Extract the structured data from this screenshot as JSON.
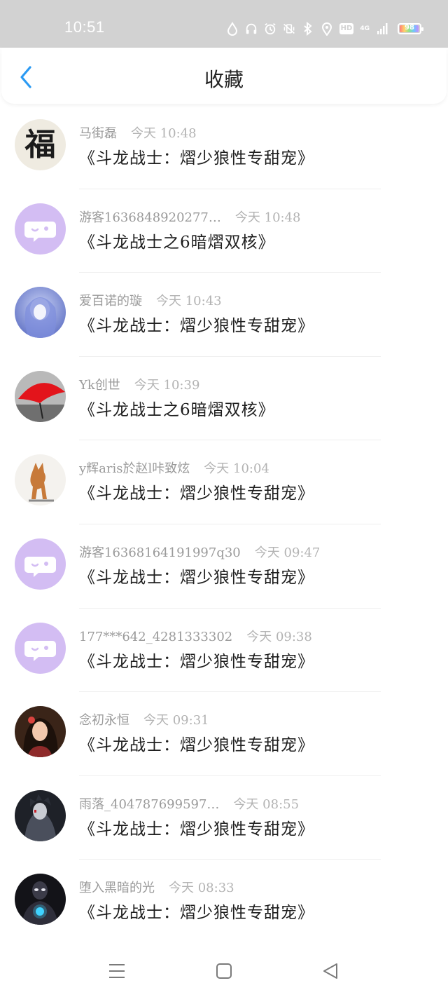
{
  "status_bar": {
    "time": "10:51",
    "network": "4G",
    "hd_label": "HD",
    "battery_level": "98",
    "icons": [
      "water-drop-icon",
      "headphones-icon",
      "alarm-icon",
      "vibrate-off-icon",
      "bluetooth-icon",
      "location-icon",
      "hd-icon",
      "network-4g-icon",
      "signal-icon",
      "battery-icon"
    ]
  },
  "header": {
    "title": "收藏",
    "back_icon": "chevron-left-icon"
  },
  "colors": {
    "accent": "#2b9af3",
    "status_bar_bg": "#d2d2d2",
    "meta_text": "#9a9a9a",
    "default_avatar_bg": "#d3bdf3"
  },
  "items": [
    {
      "name": "马街磊",
      "time": "今天 10:48",
      "title": "《斗龙战士：熠少狼性专甜宠》",
      "avatar": "fu-character-avatar"
    },
    {
      "name": "游客1636848920277…",
      "time": "今天 10:48",
      "title": "《斗龙战士之6暗熠双核》",
      "avatar": "default-chat-avatar"
    },
    {
      "name": "爱百诺的璇",
      "time": "今天 10:43",
      "title": "《斗龙战士：熠少狼性专甜宠》",
      "avatar": "anime-girl-blue-avatar"
    },
    {
      "name": "Yk创世",
      "time": "今天 10:39",
      "title": "《斗龙战士之6暗熠双核》",
      "avatar": "red-umbrella-avatar"
    },
    {
      "name": "y辉aris於赵l咔致炫",
      "time": "今天 10:04",
      "title": "《斗龙战士：熠少狼性专甜宠》",
      "avatar": "dog-avatar"
    },
    {
      "name": "游客16368164191997q30",
      "time": "今天 09:47",
      "title": "《斗龙战士：熠少狼性专甜宠》",
      "avatar": "default-chat-avatar"
    },
    {
      "name": "177***642_4281333302",
      "time": "今天 09:38",
      "title": "《斗龙战士：熠少狼性专甜宠》",
      "avatar": "default-chat-avatar"
    },
    {
      "name": "念初永恒",
      "time": "今天 09:31",
      "title": "《斗龙战士：熠少狼性专甜宠》",
      "avatar": "girl-portrait-avatar"
    },
    {
      "name": "雨落_404787699597…",
      "time": "今天 08:55",
      "title": "《斗龙战士：熠少狼性专甜宠》",
      "avatar": "dark-character-avatar"
    },
    {
      "name": "堕入黑暗的光",
      "time": "今天 08:33",
      "title": "《斗龙战士：熠少狼性专甜宠》",
      "avatar": "dark-hero-avatar"
    }
  ],
  "nav_bar": {
    "icons": [
      "menu-icon",
      "home-square-icon",
      "back-triangle-icon"
    ]
  }
}
